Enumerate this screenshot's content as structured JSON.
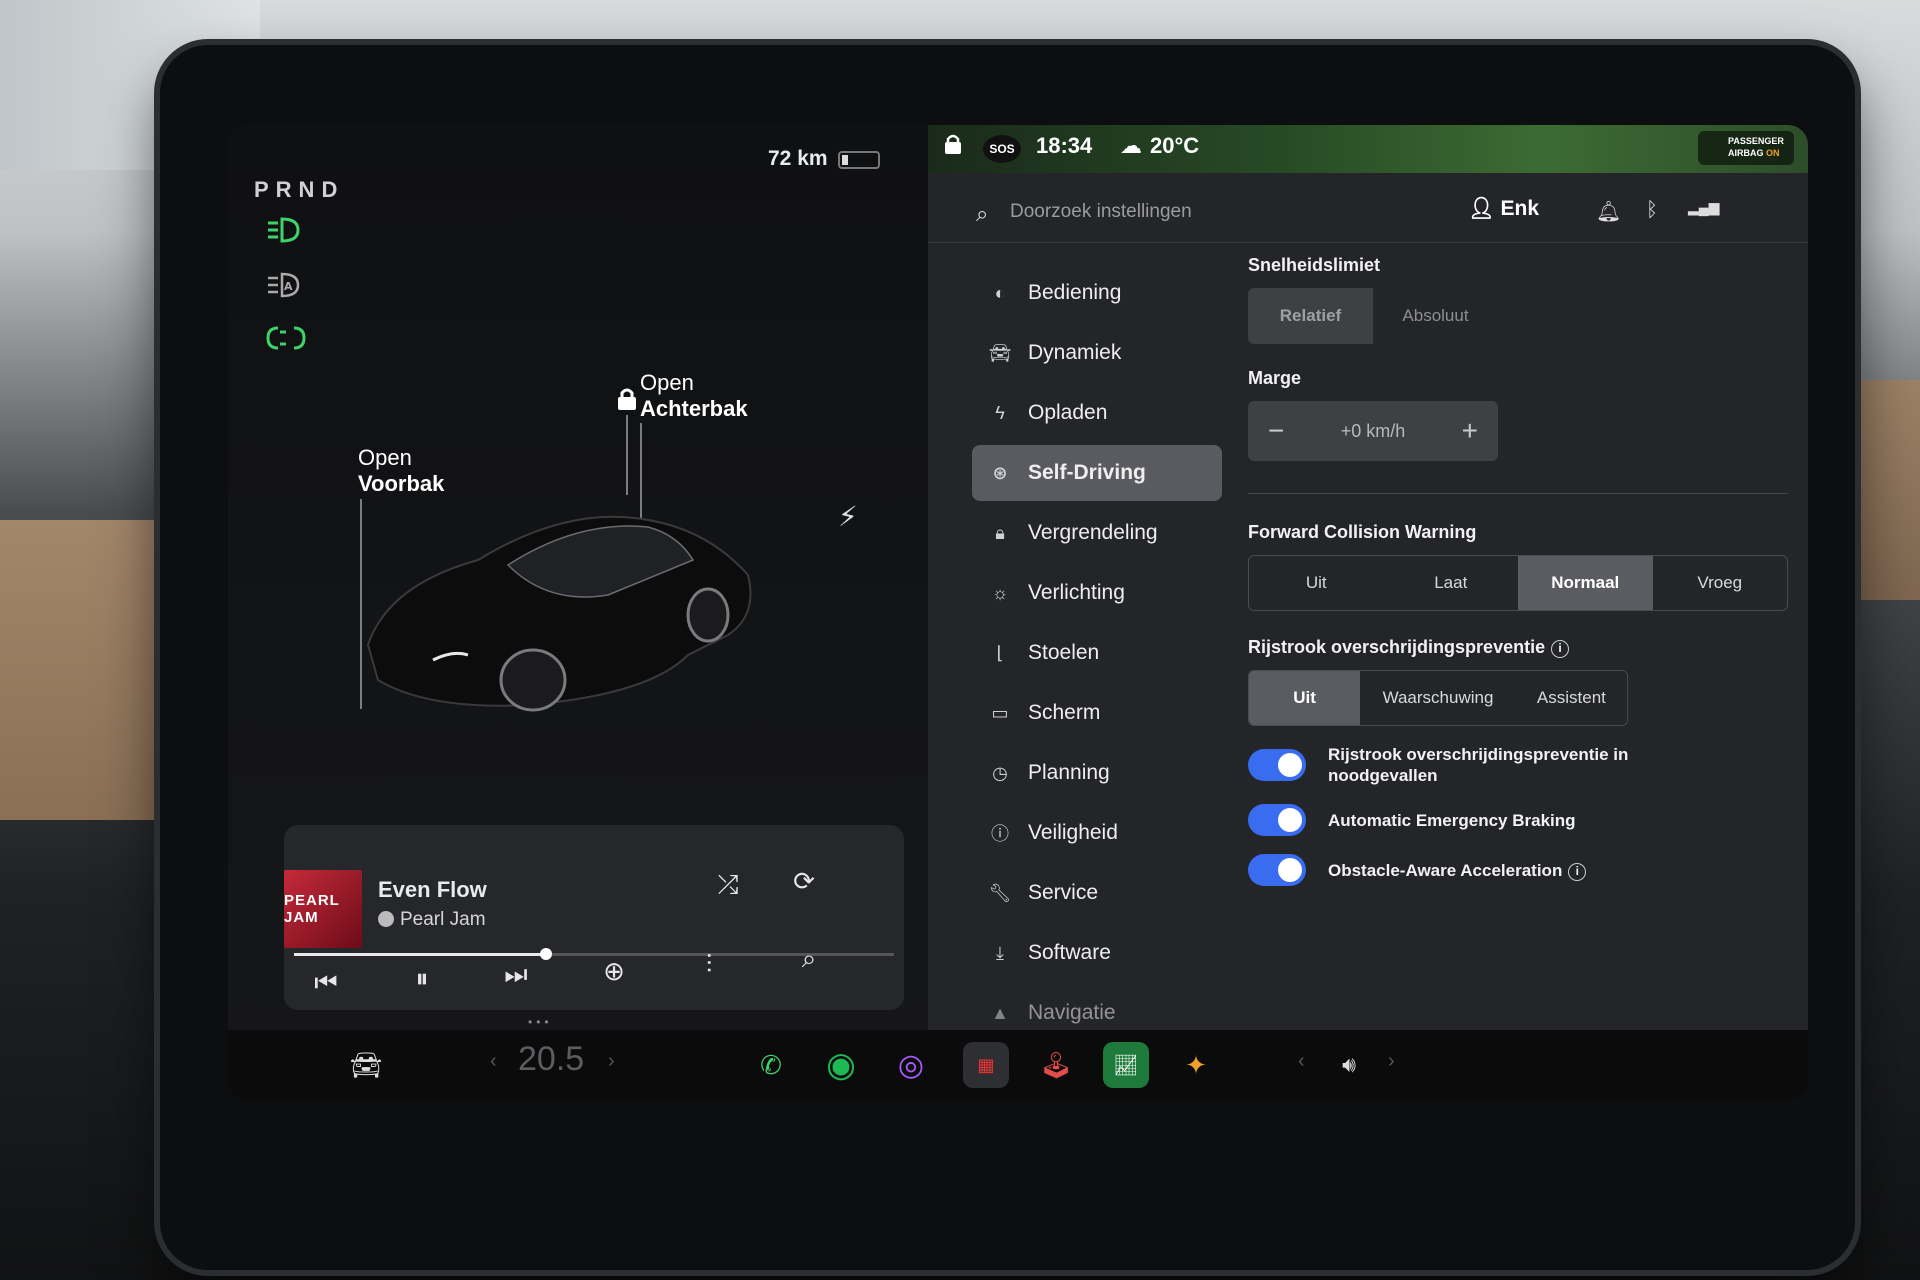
{
  "car": {
    "gear": "PRND",
    "range": "72 km",
    "frunk_label_top": "Open",
    "frunk_label_bottom": "Voorbak",
    "trunk_label_top": "Open",
    "trunk_label_bottom": "Achterbak"
  },
  "media": {
    "album_art_text": "PEARL JAM",
    "song": "Even Flow",
    "artist": "Pearl Jam",
    "progress": 0.42
  },
  "status_bar": {
    "time": "18:34",
    "temperature": "20°C",
    "sos": "SOS",
    "airbag_line1": "PASSENGER",
    "airbag_line2": "AIRBAG",
    "airbag_state": "ON"
  },
  "header": {
    "search_placeholder": "Doorzoek instellingen",
    "user": "Enk"
  },
  "menu": {
    "items": [
      {
        "label": "Bediening",
        "icon": "toggle-icon"
      },
      {
        "label": "Dynamiek",
        "icon": "car-icon"
      },
      {
        "label": "Opladen",
        "icon": "bolt-icon"
      },
      {
        "label": "Self-Driving",
        "icon": "steering-wheel-icon"
      },
      {
        "label": "Vergrendeling",
        "icon": "lock-icon"
      },
      {
        "label": "Verlichting",
        "icon": "sun-icon"
      },
      {
        "label": "Stoelen",
        "icon": "seat-icon"
      },
      {
        "label": "Scherm",
        "icon": "display-icon"
      },
      {
        "label": "Planning",
        "icon": "clock-icon"
      },
      {
        "label": "Veiligheid",
        "icon": "info-icon"
      },
      {
        "label": "Service",
        "icon": "wrench-icon"
      },
      {
        "label": "Software",
        "icon": "download-icon"
      },
      {
        "label": "Navigatie",
        "icon": "navigation-icon"
      }
    ],
    "active": "Self-Driving"
  },
  "settings": {
    "speed_limit": {
      "label": "Snelheidslimiet",
      "options": [
        "Relatief",
        "Absoluut"
      ],
      "selected": "Relatief"
    },
    "margin": {
      "label": "Marge",
      "minus": "−",
      "value": "+0 km/h",
      "plus": "+"
    },
    "fcw": {
      "label": "Forward Collision Warning",
      "options": [
        "Uit",
        "Laat",
        "Normaal",
        "Vroeg"
      ],
      "selected": "Normaal"
    },
    "lane_departure": {
      "label": "Rijstrook overschrijdingspreventie",
      "options": [
        "Uit",
        "Waarschuwing",
        "Assistent"
      ],
      "selected": "Uit"
    },
    "toggles": [
      {
        "line1": "Rijstrook overschrijdingspreventie in",
        "line2": "noodgevallen",
        "on": true
      },
      {
        "line1": "Automatic Emergency Braking",
        "line2": "",
        "on": true
      },
      {
        "line1": "Obstacle-Aware Acceleration",
        "line2": "",
        "on": true
      }
    ]
  },
  "bottom": {
    "cabin_temp": "20.5"
  },
  "colors": {
    "accent_toggle": "#3a6cf0",
    "lights_green": "#3fd26a",
    "spotify_green": "#1db954"
  }
}
